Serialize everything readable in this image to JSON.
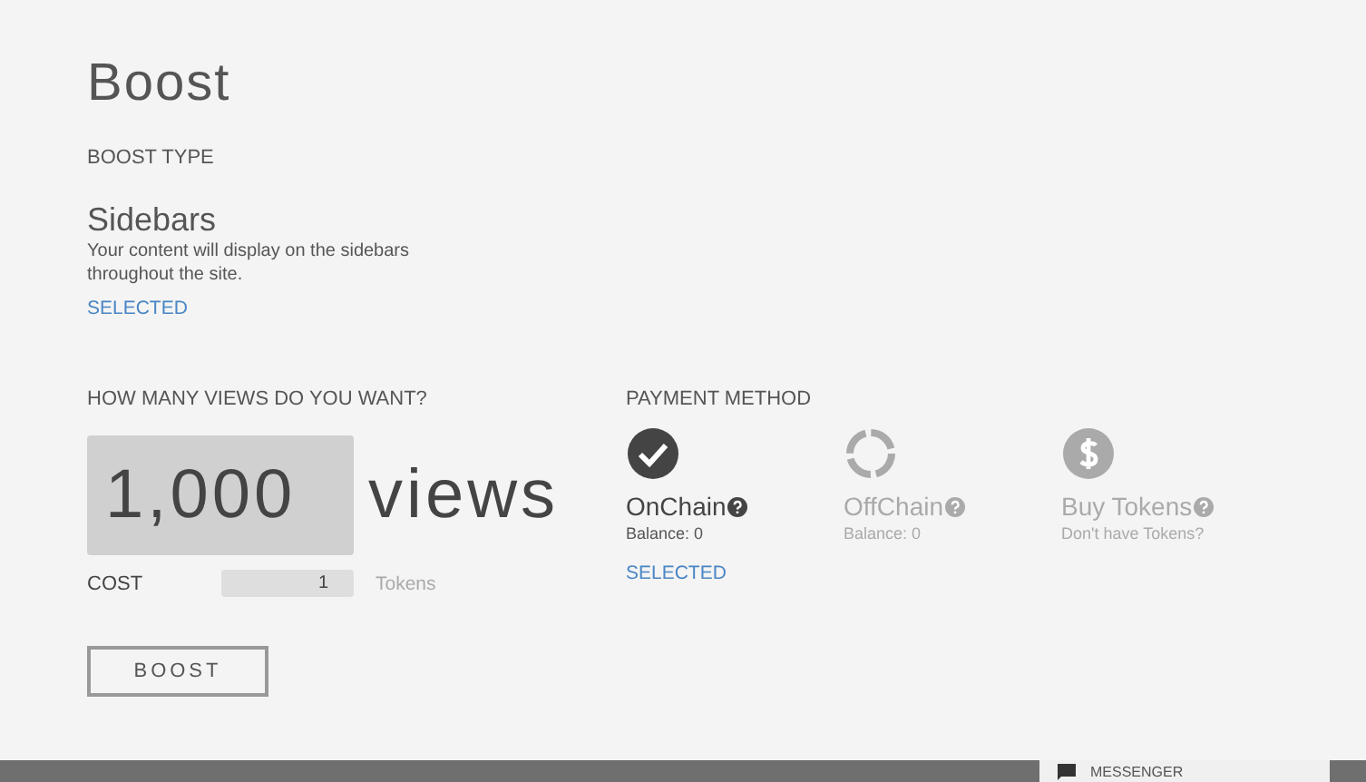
{
  "title": "Boost",
  "boost_type": {
    "heading": "BOOST TYPE",
    "items": [
      {
        "name": "Sidebars",
        "description": "Your content will display on the sidebars throughout the site.",
        "selected": true,
        "selected_label": "SELECTED"
      }
    ]
  },
  "views": {
    "heading": "HOW MANY VIEWS DO YOU WANT?",
    "value": "1,000",
    "unit": "views",
    "cost_label": "COST",
    "cost_value": "1",
    "cost_unit": "Tokens"
  },
  "boost_button": "BOOST",
  "payment": {
    "heading": "PAYMENT METHOD",
    "selected_label": "SELECTED",
    "methods": [
      {
        "kind": "check",
        "name": "OnChain",
        "sub": "Balance: 0",
        "selected": true
      },
      {
        "kind": "ring",
        "name": "OffChain",
        "sub": "Balance: 0",
        "selected": false
      },
      {
        "kind": "dollar",
        "name": "Buy Tokens",
        "sub": "Don't have Tokens?",
        "selected": false
      }
    ]
  },
  "messenger": {
    "label": "MESSENGER"
  }
}
